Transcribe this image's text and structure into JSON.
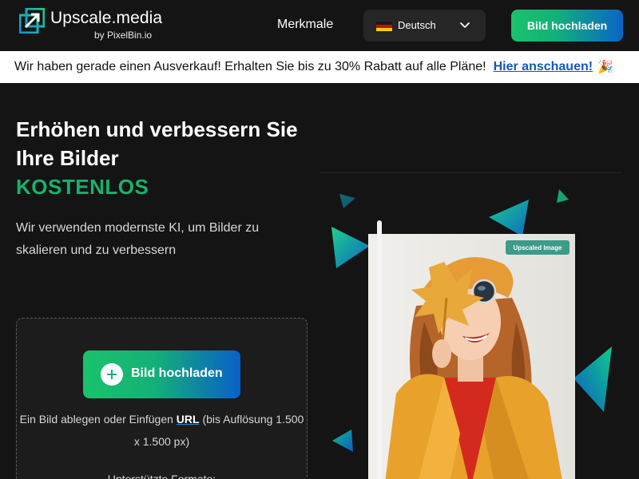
{
  "header": {
    "logo_title": "Upscale.media",
    "logo_by": "by",
    "logo_sub_brand": "PixelBin.io",
    "nav_features": "Merkmale",
    "language": "Deutsch",
    "upload_label": "Bild hochladen"
  },
  "banner": {
    "text": "Wir haben gerade einen Ausverkauf! Erhalten Sie bis zu 30% Rabatt auf alle Pläne!",
    "link": "Hier anschauen!",
    "emoji": "🎉"
  },
  "hero": {
    "title": "Erhöhen und verbessern Sie Ihre Bilder",
    "highlight": "KOSTENLOS",
    "description": "Wir verwenden modernste KI, um Bilder zu skalieren und zu verbessern"
  },
  "upload_box": {
    "button_label": "Bild hochladen",
    "drop_prefix": "Ein Bild ablegen oder Einfügen",
    "drop_url": "URL",
    "drop_suffix": "(bis Auflösung 1.500 x 1.500 px)",
    "formats_label": "Unterstützte Formate:"
  },
  "preview": {
    "badge": "Upscaled Image"
  },
  "colors": {
    "accent_green": "#17b26a",
    "accent_blue": "#0a64c8",
    "link_blue": "#1657b5",
    "background": "#141414"
  },
  "icons": {
    "logo": "upscale-arrow-icon",
    "language_flag": "germany-flag-icon",
    "dropdown": "chevron-down-icon",
    "upload": "plus-circle-icon"
  }
}
